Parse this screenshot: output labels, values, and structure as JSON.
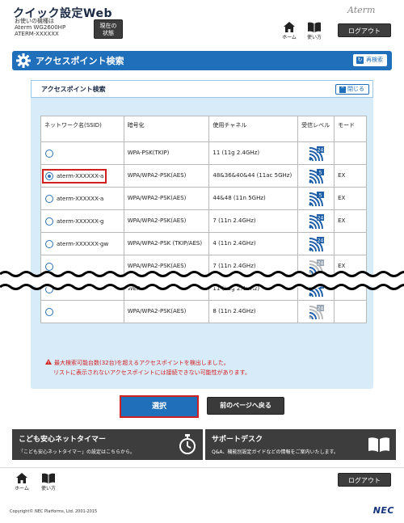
{
  "header": {
    "app_title": "クイック設定Web",
    "device_lines": [
      "お使いの機種は",
      "Aterm WG2600HP",
      "ATERM-XXXXXX"
    ],
    "status_button": [
      "現在の",
      "状態"
    ],
    "brand": "Aterm",
    "home_label": "ホーム",
    "help_label": "使い方",
    "logout_label": "ログアウト"
  },
  "section": {
    "title": "アクセスポイント検索",
    "rescan_label": "再検索"
  },
  "panel": {
    "title": "アクセスポイント検索",
    "collapse_label": "閉じる"
  },
  "table": {
    "headers": [
      "ネットワーク名(SSID)",
      "暗号化",
      "使用チャネル",
      "受信レベル",
      "モード"
    ],
    "rows": [
      {
        "ssid": "",
        "enc": "WPA-PSK(TKIP)",
        "channel": "11 (11g 2.4GHz)",
        "band": "24",
        "mode": "",
        "selected": false,
        "signal": 4
      },
      {
        "ssid": "aterm-XXXXXX-a",
        "enc": "WPA/WPA2-PSK(AES)",
        "channel": "48&36&40&44 (11ac 5GHz)",
        "band": "5",
        "mode": "EX",
        "selected": true,
        "signal": 4
      },
      {
        "ssid": "aterm-XXXXXX-a",
        "enc": "WPA/WPA2-PSK(AES)",
        "channel": "44&48 (11n 5GHz)",
        "band": "5",
        "mode": "EX",
        "selected": false,
        "signal": 4
      },
      {
        "ssid": "aterm-XXXXXX-g",
        "enc": "WPA/WPA2-PSK(AES)",
        "channel": "7 (11n 2.4GHz)",
        "band": "24",
        "mode": "EX",
        "selected": false,
        "signal": 4
      },
      {
        "ssid": "aterm-XXXXXX-gw",
        "enc": "WPA/WPA2-PSK (TKIP/AES)",
        "channel": "4 (11n 2.4GHz)",
        "band": "24",
        "mode": "",
        "selected": false,
        "signal": 4
      },
      {
        "ssid": "",
        "enc": "WPA/WPA2-PSK(AES)",
        "channel": "7 (11n 2.4GHz)",
        "band": "24",
        "mode": "EX",
        "selected": false,
        "signal": 2
      },
      {
        "ssid": "",
        "enc": "WEP",
        "channel": "11 (11g 2.4GHz)",
        "band": "24",
        "mode": "",
        "selected": false,
        "signal": 4
      },
      {
        "ssid": "",
        "enc": "WPA/WPA2-PSK(AES)",
        "channel": "8 (11n 2.4GHz)",
        "band": "24",
        "mode": "",
        "selected": false,
        "signal": 2
      }
    ]
  },
  "warning": {
    "line1": "最大検索可能台数(32台)を超えるアクセスポイントを検出しました。",
    "line2": "リストに表示されないアクセスポイントには接続できない可能性があります。"
  },
  "buttons": {
    "select_label": "選択",
    "back_label": "前のページへ戻る"
  },
  "promos": [
    {
      "title": "こども安心ネットタイマー",
      "desc": "「こども安心ネットタイマー」の設定はこちらから。",
      "icon": "stopwatch-icon"
    },
    {
      "title": "サポートデスク",
      "desc": "Q&A、機能別設定ガイドなどの情報をご案内いたします。",
      "icon": "book-icon"
    }
  ],
  "footer": {
    "home_label": "ホーム",
    "help_label": "使い方",
    "logout_label": "ログアウト",
    "copyright": "Copyright© NEC Platforms, Ltd. 2001-2015",
    "nec": "NEC"
  },
  "colors": {
    "accent": "#1f6fba",
    "alert": "#d02020",
    "panel_bg": "#d8ebf8",
    "dark_button": "#3d3d3d"
  }
}
